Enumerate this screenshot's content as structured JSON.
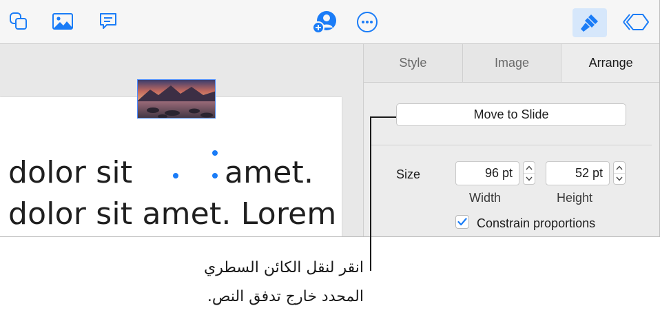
{
  "toolbar": {
    "buttons": [
      {
        "name": "shape-icon"
      },
      {
        "name": "media-icon"
      },
      {
        "name": "comment-icon"
      },
      {
        "name": "collaborate-icon"
      },
      {
        "name": "more-icon"
      },
      {
        "name": "format-icon",
        "active": true
      },
      {
        "name": "animate-icon"
      }
    ]
  },
  "slide": {
    "line1_before": "dolor sit",
    "line1_after": "amet.",
    "line2": "dolor sit amet. Lorem"
  },
  "inspector": {
    "tabs": [
      "Style",
      "Image",
      "Arrange"
    ],
    "selected_tab": "Arrange",
    "move_button": "Move to Slide",
    "size_label": "Size",
    "width_value": "96 pt",
    "height_value": "52 pt",
    "width_label": "Width",
    "height_label": "Height",
    "constrain_label": "Constrain proportions",
    "constrain_checked": true
  },
  "callout": {
    "line1": "انقر لنقل الكائن السطري",
    "line2": "المحدد خارج تدفق النص."
  },
  "colors": {
    "accent": "#1a7cf7",
    "active_button_bg": "#d6e7fb"
  }
}
